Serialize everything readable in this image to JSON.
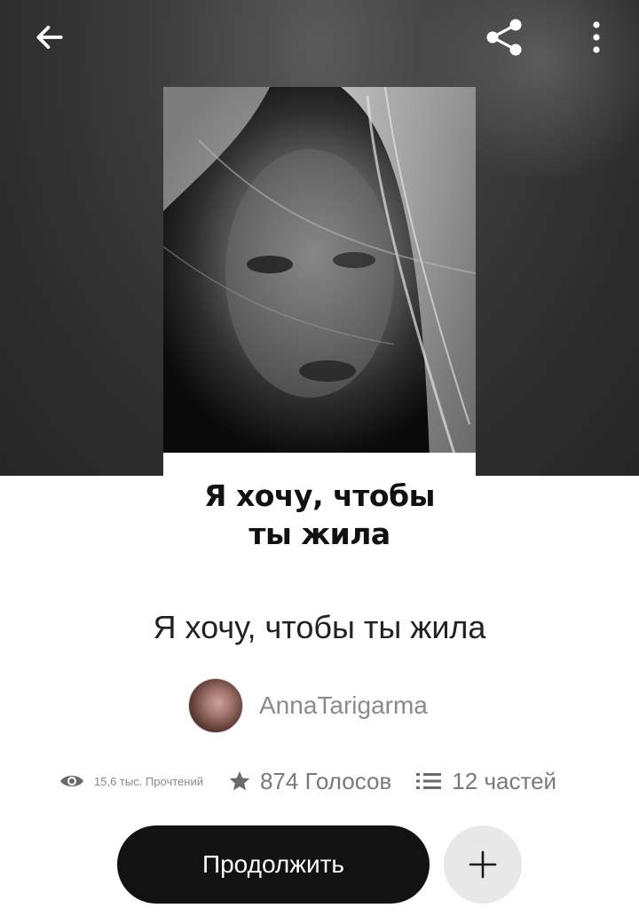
{
  "toolbar": {
    "back_icon": "arrow-left-icon",
    "share_icon": "share-icon",
    "more_icon": "more-vertical-icon"
  },
  "cover": {
    "title_line1": "Я хочу, чтобы",
    "title_line2": "ты жила"
  },
  "story": {
    "title": "Я хочу, чтобы ты жила",
    "author": "AnnaTarigarma"
  },
  "stats": {
    "views": "15,6 тыс. Прочтений",
    "votes": "874 Голосов",
    "parts": "12 частей"
  },
  "actions": {
    "continue_label": "Продолжить",
    "add_icon": "plus-icon"
  },
  "colors": {
    "header_bg": "#2c2c2c",
    "button_dark": "#121212",
    "button_light": "#e8e8e8",
    "muted_text": "#7a7a7a"
  }
}
